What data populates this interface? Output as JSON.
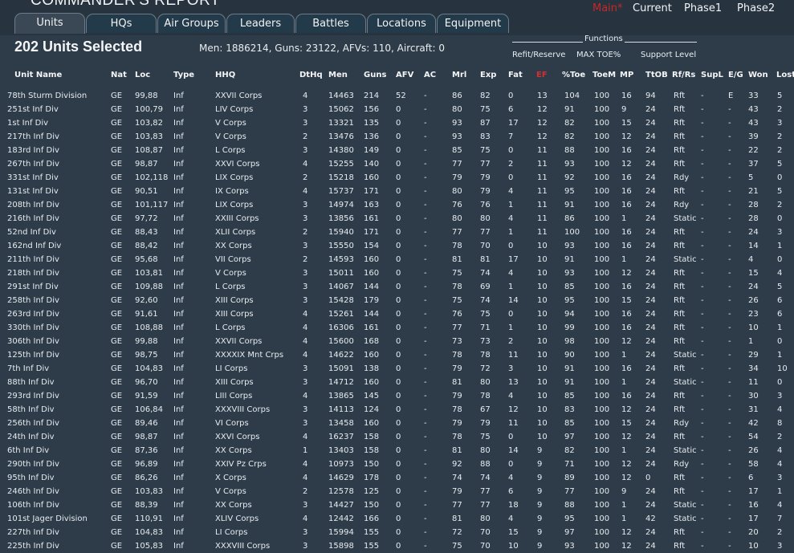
{
  "window": {
    "title": "COMMANDER'S REPORT"
  },
  "phases": [
    {
      "label": "Main*",
      "main": true
    },
    {
      "label": "Current",
      "main": false
    },
    {
      "label": "Phase1",
      "main": false
    },
    {
      "label": "Phase2",
      "main": false
    }
  ],
  "tabs": [
    {
      "label": "Units",
      "active": true
    },
    {
      "label": "HQs",
      "active": false
    },
    {
      "label": "Air Groups",
      "active": false
    },
    {
      "label": "Leaders",
      "active": false
    },
    {
      "label": "Battles",
      "active": false
    },
    {
      "label": "Locations",
      "active": false
    },
    {
      "label": "Equipment",
      "active": false
    }
  ],
  "selection": {
    "count_label": "202 Units Selected",
    "summary": "Men: 1886214, Guns: 23122, AFVs: 110, Aircraft: 0"
  },
  "functions": {
    "label": "Functions",
    "items": [
      "Refit/Reserve",
      "MAX TOE%",
      "Support Level"
    ]
  },
  "columns": [
    "Unit Name",
    "Nat",
    "Loc",
    "Type",
    "HHQ",
    "DtHq",
    "Men",
    "Guns",
    "AFV",
    "AC",
    "Mrl",
    "Exp",
    "Fat",
    "EF",
    "%Toe",
    "ToeM",
    "MP",
    "TtOB",
    "Rf/Rs",
    "SupL",
    "E/G",
    "Won",
    "Lost"
  ],
  "colors": {
    "background": "#2e3c4a",
    "accent_red": "#d32f2f"
  },
  "rows": [
    [
      "78th Sturm Division",
      "GE",
      "99,88",
      "Inf",
      "XXVII Corps",
      "4",
      "14463",
      "214",
      "52",
      "-",
      "86",
      "82",
      "0",
      "13",
      "104",
      "100",
      "16",
      "94",
      "Rft",
      "-",
      "E",
      "33",
      "5"
    ],
    [
      "251st Inf Div",
      "GE",
      "100,79",
      "Inf",
      "LIV Corps",
      "3",
      "15062",
      "156",
      "0",
      "-",
      "80",
      "75",
      "6",
      "12",
      "91",
      "100",
      "9",
      "24",
      "Rft",
      "-",
      "-",
      "43",
      "2"
    ],
    [
      "1st Inf Div",
      "GE",
      "103,82",
      "Inf",
      "V Corps",
      "3",
      "13321",
      "135",
      "0",
      "-",
      "93",
      "87",
      "17",
      "12",
      "82",
      "100",
      "15",
      "24",
      "Rft",
      "-",
      "-",
      "43",
      "3"
    ],
    [
      "217th Inf Div",
      "GE",
      "103,83",
      "Inf",
      "V Corps",
      "2",
      "13476",
      "136",
      "0",
      "-",
      "93",
      "83",
      "7",
      "12",
      "82",
      "100",
      "12",
      "24",
      "Rft",
      "-",
      "-",
      "39",
      "2"
    ],
    [
      "183rd Inf Div",
      "GE",
      "108,87",
      "Inf",
      "L Corps",
      "3",
      "14380",
      "149",
      "0",
      "-",
      "85",
      "75",
      "0",
      "11",
      "88",
      "100",
      "16",
      "24",
      "Rft",
      "-",
      "-",
      "22",
      "2"
    ],
    [
      "267th Inf Div",
      "GE",
      "98,87",
      "Inf",
      "XXVI Corps",
      "4",
      "15255",
      "140",
      "0",
      "-",
      "77",
      "77",
      "2",
      "11",
      "93",
      "100",
      "12",
      "24",
      "Rft",
      "-",
      "-",
      "37",
      "5"
    ],
    [
      "331st Inf Div",
      "GE",
      "102,118",
      "Inf",
      "LIX Corps",
      "2",
      "15218",
      "160",
      "0",
      "-",
      "79",
      "79",
      "0",
      "11",
      "92",
      "100",
      "16",
      "24",
      "Rdy",
      "-",
      "-",
      "5",
      "0"
    ],
    [
      "131st Inf Div",
      "GE",
      "90,51",
      "Inf",
      "IX Corps",
      "4",
      "15737",
      "171",
      "0",
      "-",
      "80",
      "79",
      "4",
      "11",
      "95",
      "100",
      "16",
      "24",
      "Rft",
      "-",
      "-",
      "21",
      "5"
    ],
    [
      "208th Inf Div",
      "GE",
      "101,117",
      "Inf",
      "LIX Corps",
      "3",
      "14974",
      "163",
      "0",
      "-",
      "76",
      "76",
      "1",
      "11",
      "91",
      "100",
      "16",
      "24",
      "Rdy",
      "-",
      "-",
      "28",
      "2"
    ],
    [
      "216th Inf Div",
      "GE",
      "97,72",
      "Inf",
      "XXIII Corps",
      "3",
      "13856",
      "161",
      "0",
      "-",
      "80",
      "80",
      "4",
      "11",
      "86",
      "100",
      "1",
      "24",
      "Static",
      "-",
      "-",
      "28",
      "0"
    ],
    [
      "52nd Inf Div",
      "GE",
      "88,43",
      "Inf",
      "XLII Corps",
      "2",
      "15940",
      "171",
      "0",
      "-",
      "77",
      "77",
      "1",
      "11",
      "100",
      "100",
      "16",
      "24",
      "Rft",
      "-",
      "-",
      "24",
      "3"
    ],
    [
      "162nd Inf Div",
      "GE",
      "88,42",
      "Inf",
      "XX Corps",
      "3",
      "15550",
      "154",
      "0",
      "-",
      "78",
      "70",
      "0",
      "10",
      "93",
      "100",
      "16",
      "24",
      "Rft",
      "-",
      "-",
      "14",
      "1"
    ],
    [
      "211th Inf Div",
      "GE",
      "95,68",
      "Inf",
      "VII Corps",
      "2",
      "14593",
      "160",
      "0",
      "-",
      "81",
      "81",
      "17",
      "10",
      "91",
      "100",
      "1",
      "24",
      "Static",
      "-",
      "-",
      "4",
      "0"
    ],
    [
      "218th Inf Div",
      "GE",
      "103,81",
      "Inf",
      "V Corps",
      "3",
      "15011",
      "160",
      "0",
      "-",
      "75",
      "74",
      "4",
      "10",
      "93",
      "100",
      "12",
      "24",
      "Rft",
      "-",
      "-",
      "15",
      "4"
    ],
    [
      "291st Inf Div",
      "GE",
      "109,88",
      "Inf",
      "L Corps",
      "3",
      "14067",
      "144",
      "0",
      "-",
      "78",
      "69",
      "1",
      "10",
      "85",
      "100",
      "16",
      "24",
      "Rft",
      "-",
      "-",
      "24",
      "5"
    ],
    [
      "258th Inf Div",
      "GE",
      "92,60",
      "Inf",
      "XIII Corps",
      "3",
      "15428",
      "179",
      "0",
      "-",
      "75",
      "74",
      "14",
      "10",
      "95",
      "100",
      "15",
      "24",
      "Rft",
      "-",
      "-",
      "26",
      "6"
    ],
    [
      "263rd Inf Div",
      "GE",
      "91,61",
      "Inf",
      "XIII Corps",
      "4",
      "15261",
      "144",
      "0",
      "-",
      "76",
      "75",
      "0",
      "10",
      "94",
      "100",
      "16",
      "24",
      "Rft",
      "-",
      "-",
      "23",
      "6"
    ],
    [
      "330th Inf Div",
      "GE",
      "108,88",
      "Inf",
      "L Corps",
      "4",
      "16306",
      "161",
      "0",
      "-",
      "77",
      "71",
      "1",
      "10",
      "99",
      "100",
      "16",
      "24",
      "Rft",
      "-",
      "-",
      "10",
      "1"
    ],
    [
      "306th Inf Div",
      "GE",
      "99,88",
      "Inf",
      "XXVII Corps",
      "4",
      "15600",
      "168",
      "0",
      "-",
      "73",
      "73",
      "2",
      "10",
      "98",
      "100",
      "12",
      "24",
      "Rft",
      "-",
      "-",
      "1",
      "0"
    ],
    [
      "125th Inf Div",
      "GE",
      "98,75",
      "Inf",
      "XXXXIX Mnt Crps",
      "4",
      "14622",
      "160",
      "0",
      "-",
      "78",
      "78",
      "11",
      "10",
      "90",
      "100",
      "1",
      "24",
      "Static",
      "-",
      "-",
      "29",
      "1"
    ],
    [
      "7th Inf Div",
      "GE",
      "104,83",
      "Inf",
      "LI Corps",
      "3",
      "15091",
      "138",
      "0",
      "-",
      "79",
      "72",
      "3",
      "10",
      "91",
      "100",
      "16",
      "24",
      "Rft",
      "-",
      "-",
      "34",
      "10"
    ],
    [
      "88th Inf Div",
      "GE",
      "96,70",
      "Inf",
      "XIII Corps",
      "3",
      "14712",
      "160",
      "0",
      "-",
      "81",
      "80",
      "13",
      "10",
      "91",
      "100",
      "1",
      "24",
      "Static",
      "-",
      "-",
      "11",
      "0"
    ],
    [
      "293rd Inf Div",
      "GE",
      "91,59",
      "Inf",
      "LIII Corps",
      "4",
      "13865",
      "145",
      "0",
      "-",
      "79",
      "78",
      "4",
      "10",
      "85",
      "100",
      "16",
      "24",
      "Rft",
      "-",
      "-",
      "30",
      "3"
    ],
    [
      "58th Inf Div",
      "GE",
      "106,84",
      "Inf",
      "XXXVIII Corps",
      "3",
      "14113",
      "124",
      "0",
      "-",
      "78",
      "67",
      "12",
      "10",
      "83",
      "100",
      "12",
      "24",
      "Rft",
      "-",
      "-",
      "31",
      "4"
    ],
    [
      "256th Inf Div",
      "GE",
      "89,46",
      "Inf",
      "VI Corps",
      "3",
      "13458",
      "160",
      "0",
      "-",
      "79",
      "79",
      "11",
      "10",
      "85",
      "100",
      "15",
      "24",
      "Rdy",
      "-",
      "-",
      "42",
      "8"
    ],
    [
      "24th Inf Div",
      "GE",
      "98,87",
      "Inf",
      "XXVI Corps",
      "4",
      "16237",
      "158",
      "0",
      "-",
      "78",
      "75",
      "0",
      "10",
      "97",
      "100",
      "12",
      "24",
      "Rft",
      "-",
      "-",
      "54",
      "2"
    ],
    [
      "6th Inf Div",
      "GE",
      "87,36",
      "Inf",
      "XX Corps",
      "1",
      "13403",
      "158",
      "0",
      "-",
      "81",
      "80",
      "14",
      "9",
      "82",
      "100",
      "1",
      "24",
      "Static",
      "-",
      "-",
      "26",
      "4"
    ],
    [
      "290th Inf Div",
      "GE",
      "96,89",
      "Inf",
      "XXIV Pz Crps",
      "4",
      "10973",
      "150",
      "0",
      "-",
      "92",
      "88",
      "0",
      "9",
      "71",
      "100",
      "12",
      "24",
      "Rdy",
      "-",
      "-",
      "58",
      "4"
    ],
    [
      "95th Inf Div",
      "GE",
      "86,26",
      "Inf",
      "X Corps",
      "4",
      "14629",
      "178",
      "0",
      "-",
      "74",
      "74",
      "4",
      "9",
      "89",
      "100",
      "12",
      "0",
      "Rft",
      "-",
      "-",
      "6",
      "3"
    ],
    [
      "246th Inf Div",
      "GE",
      "103,83",
      "Inf",
      "V Corps",
      "2",
      "12578",
      "125",
      "0",
      "-",
      "79",
      "77",
      "6",
      "9",
      "77",
      "100",
      "9",
      "24",
      "Rft",
      "-",
      "-",
      "17",
      "1"
    ],
    [
      "106th Inf Div",
      "GE",
      "88,39",
      "Inf",
      "XX Corps",
      "3",
      "14427",
      "150",
      "0",
      "-",
      "77",
      "77",
      "18",
      "9",
      "88",
      "100",
      "1",
      "24",
      "Static",
      "-",
      "-",
      "16",
      "4"
    ],
    [
      "101st Jager Division",
      "GE",
      "110,91",
      "Inf",
      "XLIV Corps",
      "4",
      "12442",
      "166",
      "0",
      "-",
      "81",
      "80",
      "4",
      "9",
      "95",
      "100",
      "1",
      "42",
      "Static",
      "-",
      "-",
      "17",
      "7"
    ],
    [
      "227th Inf Div",
      "GE",
      "104,83",
      "Inf",
      "LI Corps",
      "3",
      "15994",
      "155",
      "0",
      "-",
      "72",
      "70",
      "15",
      "9",
      "97",
      "100",
      "12",
      "24",
      "Rft",
      "-",
      "-",
      "20",
      "2"
    ],
    [
      "225th Inf Div",
      "GE",
      "105,83",
      "Inf",
      "XXXVIII Corps",
      "3",
      "15898",
      "155",
      "0",
      "-",
      "75",
      "70",
      "10",
      "9",
      "93",
      "100",
      "12",
      "24",
      "Rft",
      "-",
      "-",
      "10",
      "3"
    ]
  ]
}
